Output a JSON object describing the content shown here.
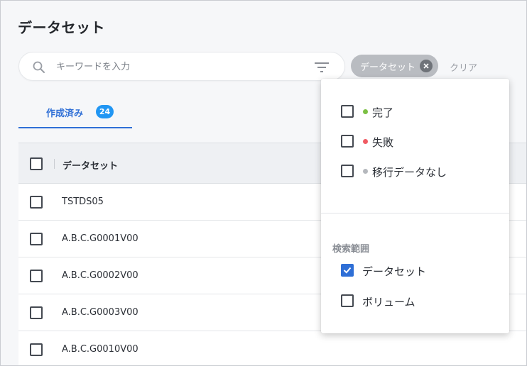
{
  "page": {
    "title": "データセット"
  },
  "search": {
    "placeholder": "キーワードを入力",
    "value": ""
  },
  "filter_chip": {
    "label": "データセット"
  },
  "clear_label": "クリア",
  "tabs": [
    {
      "label": "作成済み",
      "count": "24",
      "active": true
    }
  ],
  "table": {
    "columns": [
      "データセット"
    ],
    "rows": [
      {
        "name": "TSTDS05"
      },
      {
        "name": "A.B.C.G0001V00"
      },
      {
        "name": "A.B.C.G0002V00"
      },
      {
        "name": "A.B.C.G0003V00"
      },
      {
        "name": "A.B.C.G0010V00"
      }
    ]
  },
  "dropdown": {
    "status_options": [
      {
        "label": "完了",
        "checked": false,
        "dot_color": "#7bc043"
      },
      {
        "label": "失敗",
        "checked": false,
        "dot_color": "#f05b63"
      },
      {
        "label": "移行データなし",
        "checked": false,
        "dot_color": "#b5b8bd"
      }
    ],
    "scope_title": "検索範囲",
    "scope_options": [
      {
        "label": "データセット",
        "checked": true
      },
      {
        "label": "ボリューム",
        "checked": false
      }
    ]
  },
  "colors": {
    "accent": "#2f6fd6",
    "badge": "#2196f3",
    "chip": "#b9bcc1"
  },
  "icons": {
    "search": "search-icon",
    "filter": "filter-icon",
    "close": "close-icon",
    "check": "checkmark-icon"
  }
}
